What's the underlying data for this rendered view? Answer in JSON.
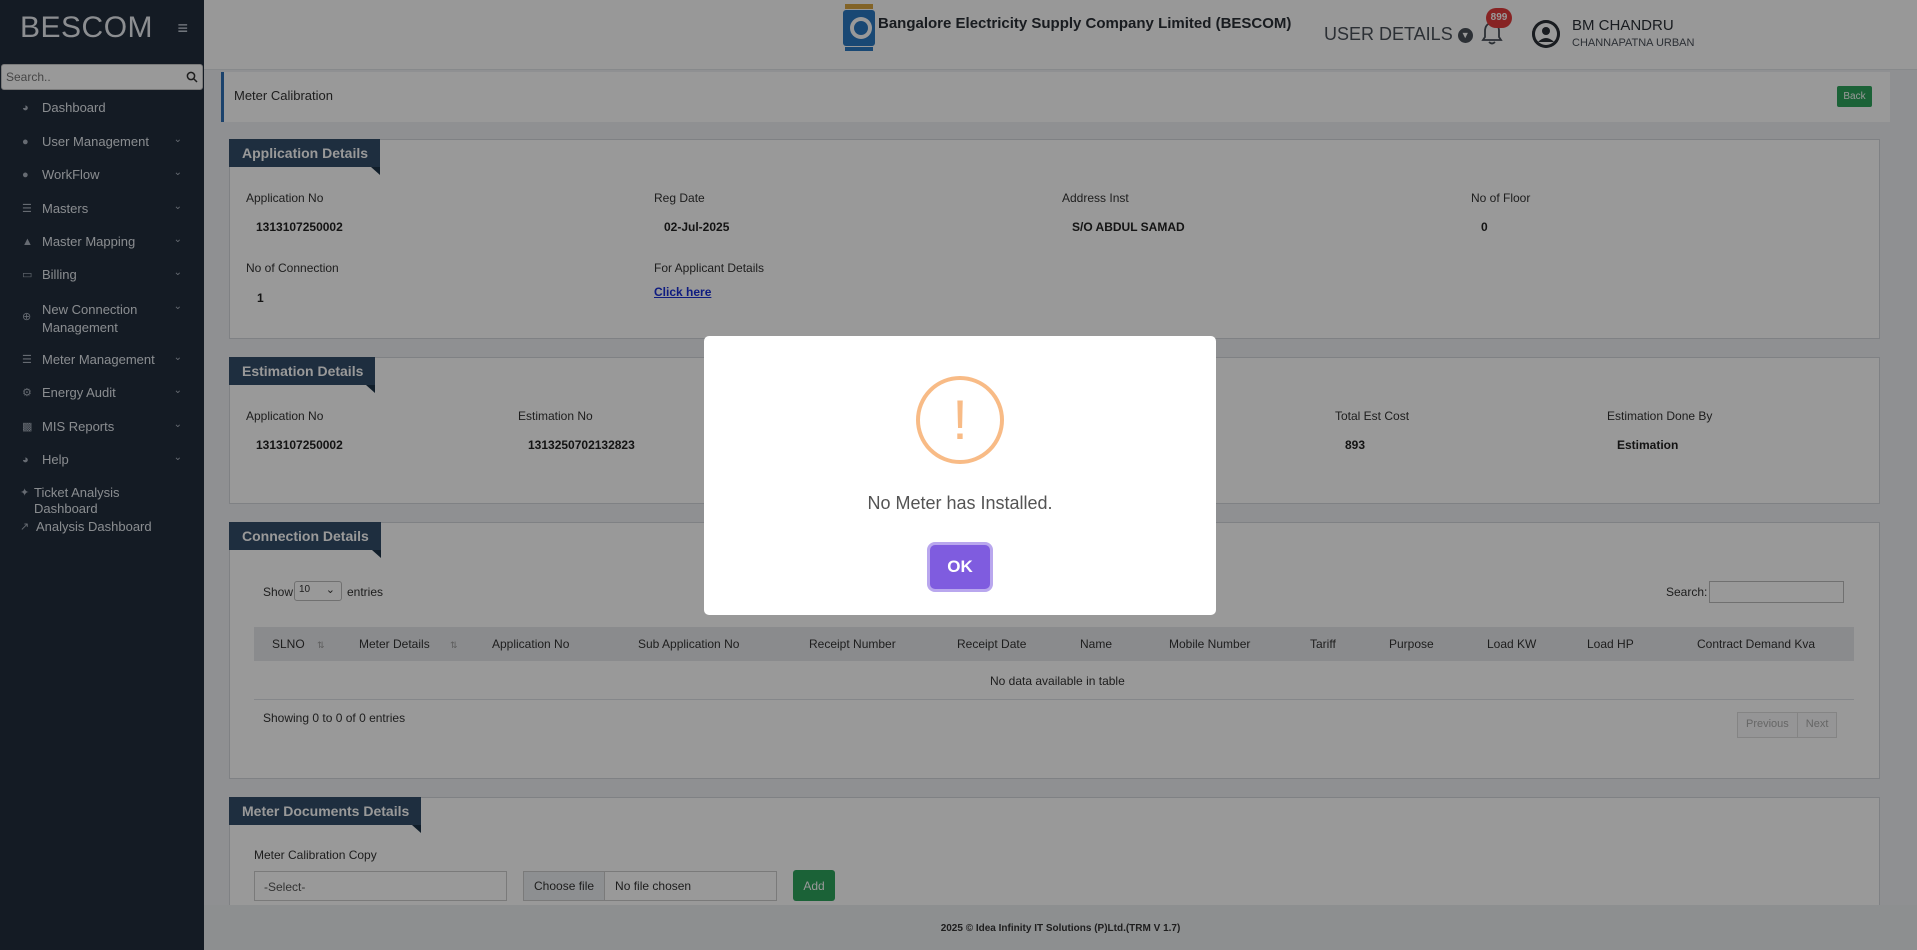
{
  "sidebar": {
    "brand": "BESCOM",
    "search_placeholder": "Search..",
    "items": [
      {
        "label": "Dashboard"
      },
      {
        "label": "User Management"
      },
      {
        "label": "WorkFlow"
      },
      {
        "label": "Masters"
      },
      {
        "label": "Master Mapping"
      },
      {
        "label": "Billing"
      },
      {
        "label": "New Connection Management"
      },
      {
        "label": "Meter Management"
      },
      {
        "label": "Energy Audit"
      },
      {
        "label": "MIS Reports"
      },
      {
        "label": "Help"
      },
      {
        "label": "Ticket Analysis Dashboard"
      },
      {
        "label": "Analysis Dashboard"
      }
    ]
  },
  "header": {
    "company": "Bangalore Electricity Supply Company Limited (BESCOM)",
    "user_details": "USER DETAILS",
    "notification_count": "899",
    "user_name": "BM CHANDRU",
    "user_location": "CHANNAPATNA URBAN"
  },
  "page": {
    "title": "Meter Calibration",
    "back_label": "Back"
  },
  "application": {
    "heading": "Application Details",
    "app_no_label": "Application No",
    "app_no": "1313107250002",
    "reg_date_label": "Reg Date",
    "reg_date": "02-Jul-2025",
    "address_label": "Address Inst",
    "address": "S/O ABDUL SAMAD",
    "floor_label": "No of Floor",
    "floor": "0",
    "conn_label": "No of Connection",
    "conn": "1",
    "applicant_label": "For Applicant Details",
    "applicant_link": "Click here"
  },
  "estimation": {
    "heading": "Estimation Details",
    "app_no_label": "Application No",
    "app_no": "1313107250002",
    "est_no_label": "Estimation No",
    "est_no": "1313250702132823",
    "cost_label": "Total Est Cost",
    "cost": "893",
    "done_by_label": "Estimation Done By",
    "done_by": "Estimation"
  },
  "connection": {
    "heading": "Connection Details",
    "show": "Show",
    "entries": "entries",
    "page_size": "10",
    "search_label": "Search:",
    "columns": [
      "SLNO",
      "Meter Details",
      "Application No",
      "Sub Application No",
      "Receipt Number",
      "Receipt Date",
      "Name",
      "Mobile Number",
      "Tariff",
      "Purpose",
      "Load KW",
      "Load HP",
      "Contract Demand Kva"
    ],
    "empty": "No data available in table",
    "showing": "Showing 0 to 0 of 0 entries",
    "prev": "Previous",
    "next": "Next"
  },
  "documents": {
    "heading": "Meter Documents Details",
    "field_label": "Meter Calibration Copy",
    "select_value": "-Select-",
    "choose_file": "Choose file",
    "no_file": "No file chosen",
    "add_label": "Add"
  },
  "footer": "2025 © Idea Infinity IT Solutions (P)Ltd.(TRM V 1.7)",
  "modal": {
    "icon": "!",
    "message": "No Meter has Installed.",
    "ok_label": "OK"
  },
  "colors": {
    "sidebar": "#222d3c",
    "section_tag": "#324e69",
    "ok_button": "#7f5cdf",
    "warning": "#f8bb86",
    "success": "#2ea35c"
  }
}
